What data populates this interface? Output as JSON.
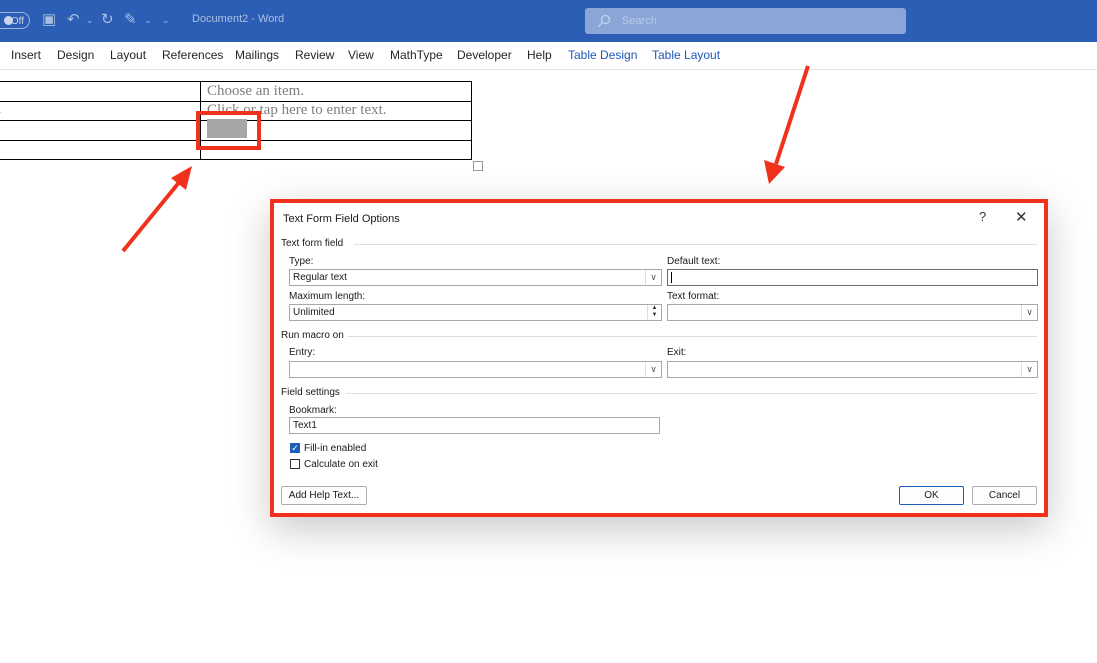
{
  "titlebar": {
    "autosave_label": "Off",
    "doc_title": "Document2  -  Word",
    "search_placeholder": "Search"
  },
  "ribbon": {
    "tabs": [
      "Insert",
      "Design",
      "Layout",
      "References",
      "Mailings",
      "Review",
      "View",
      "MathType",
      "Developer",
      "Help",
      "Table Design",
      "Table Layout"
    ]
  },
  "document": {
    "row1_right": "Choose an item.",
    "row2_left": "a",
    "row2_right": "Click or tap here to enter text."
  },
  "dialog": {
    "title": "Text Form Field Options",
    "help": "?",
    "close": "✕",
    "section_text_form_field": "Text form field",
    "type_label": "Type:",
    "type_value": "Regular text",
    "default_text_label": "Default text:",
    "default_text_value": "",
    "max_length_label": "Maximum length:",
    "max_length_value": "Unlimited",
    "text_format_label": "Text format:",
    "text_format_value": "",
    "section_run_macro": "Run macro on",
    "entry_label": "Entry:",
    "entry_value": "",
    "exit_label": "Exit:",
    "exit_value": "",
    "section_field_settings": "Field settings",
    "bookmark_label": "Bookmark:",
    "bookmark_value": "Text1",
    "fill_in_label": "Fill-in enabled",
    "fill_in_checked": true,
    "calc_label": "Calculate on exit",
    "calc_checked": false,
    "add_help_text": "Add Help Text...",
    "ok": "OK",
    "cancel": "Cancel"
  },
  "colors": {
    "titlebar": "#2b5eb4",
    "annotation_red": "#f0321d",
    "accent_blue": "#1d5dbd"
  }
}
